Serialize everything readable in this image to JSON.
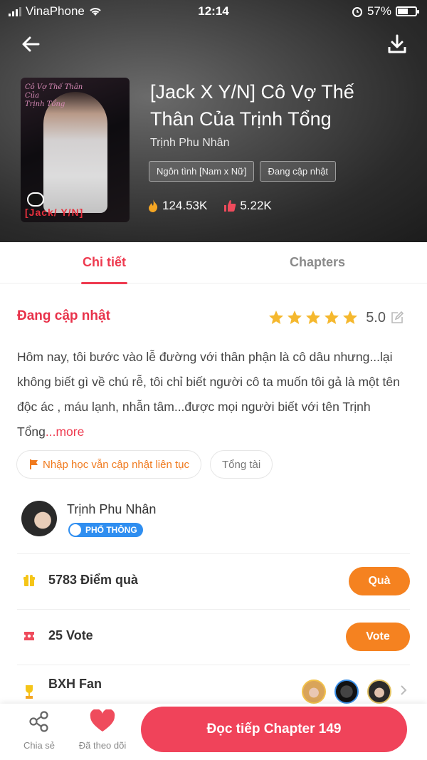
{
  "status_bar": {
    "carrier": "VinaPhone",
    "time": "12:14",
    "battery": "57%"
  },
  "book": {
    "title": "[Jack X Y/N] Cô Vợ Thế Thân Của Trịnh Tổng",
    "author": "Trịnh Phu Nhân",
    "tags": [
      "Ngôn tình [Nam x Nữ]",
      "Đang cập nhật"
    ],
    "views": "124.53K",
    "likes": "5.22K",
    "cover_badge": "[Jack/ Y/N]"
  },
  "tabs": {
    "detail": "Chi tiết",
    "chapters": "Chapters"
  },
  "detail": {
    "status": "Đang cập nhật",
    "rating": "5.0",
    "rating_stars": 5,
    "description": "Hôm nay, tôi bước vào lễ đường với thân phận là cô dâu nhưng...lại không biết gì về chú rễ, tôi chỉ biết người cô ta muốn tôi gả là một tên độc ác , máu lạnh, nhẫn tâm...được mọi người biết với tên Trịnh Tổng",
    "more_label": "...more",
    "chips": [
      "Nhập học  vẫn cập nhật liên tục",
      "Tổng tài"
    ]
  },
  "author_card": {
    "name": "Trịnh Phu Nhân",
    "badge": "PHỔ THÔNG"
  },
  "gifts": {
    "label": "5783 Điểm quà",
    "button": "Quà"
  },
  "votes": {
    "label": "25 Vote",
    "button": "Vote"
  },
  "fans": {
    "label": "BXH Fan"
  },
  "bottom_bar": {
    "share_label": "Chia sẻ",
    "follow_label": "Đã theo dõi",
    "read_button": "Đọc tiếp Chapter 149"
  },
  "colors": {
    "accent": "#ee3a4f",
    "orange": "#f58220",
    "star": "#f5b82e"
  }
}
